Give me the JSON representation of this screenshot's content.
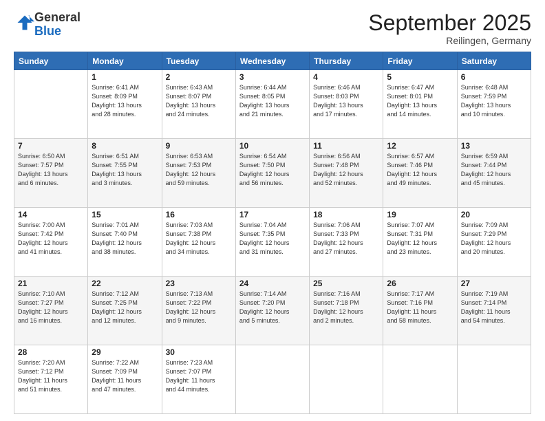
{
  "header": {
    "logo_general": "General",
    "logo_blue": "Blue",
    "month": "September 2025",
    "location": "Reilingen, Germany"
  },
  "days_of_week": [
    "Sunday",
    "Monday",
    "Tuesday",
    "Wednesday",
    "Thursday",
    "Friday",
    "Saturday"
  ],
  "weeks": [
    [
      {
        "day": "",
        "info": ""
      },
      {
        "day": "1",
        "info": "Sunrise: 6:41 AM\nSunset: 8:09 PM\nDaylight: 13 hours\nand 28 minutes."
      },
      {
        "day": "2",
        "info": "Sunrise: 6:43 AM\nSunset: 8:07 PM\nDaylight: 13 hours\nand 24 minutes."
      },
      {
        "day": "3",
        "info": "Sunrise: 6:44 AM\nSunset: 8:05 PM\nDaylight: 13 hours\nand 21 minutes."
      },
      {
        "day": "4",
        "info": "Sunrise: 6:46 AM\nSunset: 8:03 PM\nDaylight: 13 hours\nand 17 minutes."
      },
      {
        "day": "5",
        "info": "Sunrise: 6:47 AM\nSunset: 8:01 PM\nDaylight: 13 hours\nand 14 minutes."
      },
      {
        "day": "6",
        "info": "Sunrise: 6:48 AM\nSunset: 7:59 PM\nDaylight: 13 hours\nand 10 minutes."
      }
    ],
    [
      {
        "day": "7",
        "info": "Sunrise: 6:50 AM\nSunset: 7:57 PM\nDaylight: 13 hours\nand 6 minutes."
      },
      {
        "day": "8",
        "info": "Sunrise: 6:51 AM\nSunset: 7:55 PM\nDaylight: 13 hours\nand 3 minutes."
      },
      {
        "day": "9",
        "info": "Sunrise: 6:53 AM\nSunset: 7:53 PM\nDaylight: 12 hours\nand 59 minutes."
      },
      {
        "day": "10",
        "info": "Sunrise: 6:54 AM\nSunset: 7:50 PM\nDaylight: 12 hours\nand 56 minutes."
      },
      {
        "day": "11",
        "info": "Sunrise: 6:56 AM\nSunset: 7:48 PM\nDaylight: 12 hours\nand 52 minutes."
      },
      {
        "day": "12",
        "info": "Sunrise: 6:57 AM\nSunset: 7:46 PM\nDaylight: 12 hours\nand 49 minutes."
      },
      {
        "day": "13",
        "info": "Sunrise: 6:59 AM\nSunset: 7:44 PM\nDaylight: 12 hours\nand 45 minutes."
      }
    ],
    [
      {
        "day": "14",
        "info": "Sunrise: 7:00 AM\nSunset: 7:42 PM\nDaylight: 12 hours\nand 41 minutes."
      },
      {
        "day": "15",
        "info": "Sunrise: 7:01 AM\nSunset: 7:40 PM\nDaylight: 12 hours\nand 38 minutes."
      },
      {
        "day": "16",
        "info": "Sunrise: 7:03 AM\nSunset: 7:38 PM\nDaylight: 12 hours\nand 34 minutes."
      },
      {
        "day": "17",
        "info": "Sunrise: 7:04 AM\nSunset: 7:35 PM\nDaylight: 12 hours\nand 31 minutes."
      },
      {
        "day": "18",
        "info": "Sunrise: 7:06 AM\nSunset: 7:33 PM\nDaylight: 12 hours\nand 27 minutes."
      },
      {
        "day": "19",
        "info": "Sunrise: 7:07 AM\nSunset: 7:31 PM\nDaylight: 12 hours\nand 23 minutes."
      },
      {
        "day": "20",
        "info": "Sunrise: 7:09 AM\nSunset: 7:29 PM\nDaylight: 12 hours\nand 20 minutes."
      }
    ],
    [
      {
        "day": "21",
        "info": "Sunrise: 7:10 AM\nSunset: 7:27 PM\nDaylight: 12 hours\nand 16 minutes."
      },
      {
        "day": "22",
        "info": "Sunrise: 7:12 AM\nSunset: 7:25 PM\nDaylight: 12 hours\nand 12 minutes."
      },
      {
        "day": "23",
        "info": "Sunrise: 7:13 AM\nSunset: 7:22 PM\nDaylight: 12 hours\nand 9 minutes."
      },
      {
        "day": "24",
        "info": "Sunrise: 7:14 AM\nSunset: 7:20 PM\nDaylight: 12 hours\nand 5 minutes."
      },
      {
        "day": "25",
        "info": "Sunrise: 7:16 AM\nSunset: 7:18 PM\nDaylight: 12 hours\nand 2 minutes."
      },
      {
        "day": "26",
        "info": "Sunrise: 7:17 AM\nSunset: 7:16 PM\nDaylight: 11 hours\nand 58 minutes."
      },
      {
        "day": "27",
        "info": "Sunrise: 7:19 AM\nSunset: 7:14 PM\nDaylight: 11 hours\nand 54 minutes."
      }
    ],
    [
      {
        "day": "28",
        "info": "Sunrise: 7:20 AM\nSunset: 7:12 PM\nDaylight: 11 hours\nand 51 minutes."
      },
      {
        "day": "29",
        "info": "Sunrise: 7:22 AM\nSunset: 7:09 PM\nDaylight: 11 hours\nand 47 minutes."
      },
      {
        "day": "30",
        "info": "Sunrise: 7:23 AM\nSunset: 7:07 PM\nDaylight: 11 hours\nand 44 minutes."
      },
      {
        "day": "",
        "info": ""
      },
      {
        "day": "",
        "info": ""
      },
      {
        "day": "",
        "info": ""
      },
      {
        "day": "",
        "info": ""
      }
    ]
  ]
}
